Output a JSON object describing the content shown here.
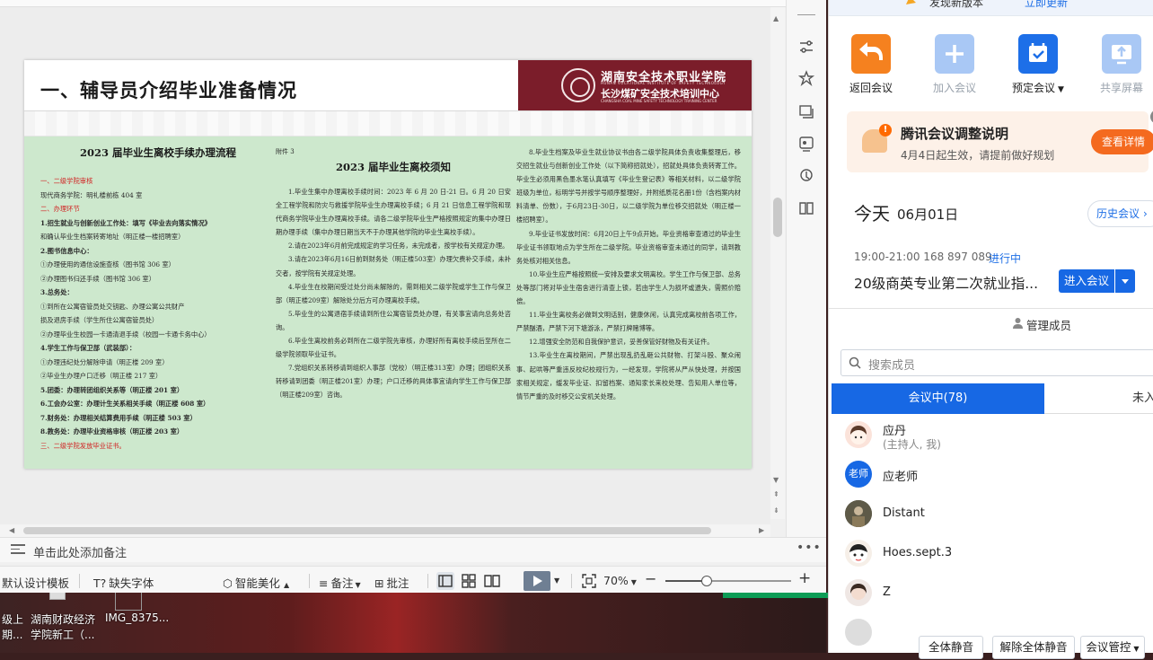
{
  "editor": {
    "notes_placeholder": "单击此处添加备注",
    "statusbar": {
      "template": "默认设计模板",
      "missing_fonts": "缺失字体",
      "smart_beautify": "智能美化",
      "notes": "备注",
      "comment": "批注",
      "zoom": "70%",
      "zoom_level": 0.33
    }
  },
  "slide": {
    "title": "一、辅导员介绍毕业准备情况",
    "logo_line1": "湖南安全技术职业学院",
    "logo_line2": "HUNAN VOCATIONAL INSTITUTE OF SAFETY TECHNOLOGY",
    "logo_line3": "长沙煤矿安全技术培训中心",
    "logo_line4": "CHANGSHA COAL MINE SAFETY TECHNOLOGY TRAINING CENTER",
    "col1": {
      "title": "2023 届毕业生离校手续办理流程",
      "lines": [
        {
          "t": "一、二级学院审核",
          "c": "red"
        },
        {
          "t": "现代商务学院：明礼楼前栋 404 室",
          "c": ""
        },
        {
          "t": "二、办理环节",
          "c": "red"
        },
        {
          "t": "1.招生就业与创新创业工作处：填写《毕业去向落实情况》",
          "c": "b"
        },
        {
          "t": "和确认毕业生档案转寄地址（明正楼一楼招聘室）",
          "c": ""
        },
        {
          "t": "2.图书信息中心：",
          "c": "b"
        },
        {
          "t": "①办理使用的通信设施查核（图书馆 306 室）",
          "c": ""
        },
        {
          "t": "②办理图书归还手续（图书馆 306 室）",
          "c": ""
        },
        {
          "t": "3.总务处：",
          "c": "b"
        },
        {
          "t": "①到所在公寓宿管员处交钥匙、办理公寓公共财产",
          "c": ""
        },
        {
          "t": "损及退房手续（学生所住公寓宿管员处）",
          "c": ""
        },
        {
          "t": "②办理毕业生校园一卡通清退手续（校园一卡通卡务中心）",
          "c": ""
        },
        {
          "t": "4.学生工作与保卫部（武装部）：",
          "c": "b"
        },
        {
          "t": "①办理违纪处分解除申请（明正楼 209 室）",
          "c": ""
        },
        {
          "t": "②毕业生办理户口迁移（明正楼 217 室）",
          "c": ""
        },
        {
          "t": "5.团委：办理转团组织关系等（明正楼 201 室）",
          "c": "b"
        },
        {
          "t": "6.工会办公室：办理计生关系相关手续（明正楼 608 室）",
          "c": "b"
        },
        {
          "t": "7.财务处：办理相关结算费用手续（明正楼 503 室）",
          "c": "b"
        },
        {
          "t": "8.教务处：办理毕业资格审核（明正楼 203 室）",
          "c": "b"
        },
        {
          "t": "三、二级学院发放毕业证书。",
          "c": "red"
        }
      ]
    },
    "col2": {
      "annex": "附件 3",
      "title": "2023 届毕业生离校须知",
      "paras": [
        "1.毕业生集中办理离校手续时间：2023 年 6 月 20 日-21 日。6 月 20 日安全工程学院和防灾与救援学院毕业生办理离校手续；6 月 21 日信息工程学院和现代商务学院毕业生办理离校手续。请各二级学院毕业生严格按照规定的集中办理日期办理手续（集中办理日期当天不于办理其他学院的毕业生离校手续）。",
        "2.请在2023年6月前完成规定的学习任务，未完成者，按学校有关规定办理。",
        "3.请在2023年6月16日前到财务处（明正楼503室）办理欠费补交手续，未补交者，按学院有关规定处理。",
        "4.毕业生在校期间受过处分尚未解除的，需到相关二级学院或学生工作与保卫部（明正楼209室）解除处分后方可办理离校手续。",
        "5.毕业生的公寓退宿手续请到所住公寓宿管员处办理，有关事宜请向总务处咨询。",
        "6.毕业生离校前务必到所在二级学院先审核，办理好所有离校手续后至所在二级学院领取毕业证书。",
        "7.党组织关系转移请到组织人事部（党校）（明正楼313室）办理；团组织关系转移请到团委（明正楼201室）办理；户口迁移的具体事宜请向学生工作与保卫部（明正楼209室）咨询。"
      ]
    },
    "col3": {
      "paras": [
        "8.毕业生档案及毕业生就业协议书由各二级学院具体负责收集整理后，移交招生就业与创新创业工作处（以下简称招就处），招就处具体负责转寄工作。毕业生必须用黑色墨水笔认真填写《毕业生登记表》等相关材料，以二级学院班级为单位，标明学号并按学号顺序整理好，并附纸质花名册1份（含档案内材料清单、份数），于6月23日-30日，以二级学院为单位移交招就处（明正楼一楼招聘室）。",
        "9.毕业证书发放时间：6月20日上午9点开始。毕业资格审查通过的毕业生毕业证书领取地点为学生所在二级学院。毕业资格审查未通过的同学，请到教务处核对相关信息。",
        "10.毕业生应严格按照统一安排及要求文明离校。学生工作与保卫部、总务处等部门将对毕业生宿舍进行清查上锁，若由学生人为损坏或遗失，需照价赔偿。",
        "11.毕业生离校务必做到文明话别，健康休闲，认真完成离校前各项工作，严禁酗酒，严禁下河下塘游泳，严禁打牌赌博等。",
        "12.增强安全防范和自我保护意识，妥善保管好财物及有关证件。",
        "13.毕业生在离校期间，严禁出现乱扔乱砸公共财物、打架斗殴、聚众闹事、起哄等严重违反校纪校规行为，一经发现，学院将从严从快处理，并按国家相关规定，缓发毕业证、扣留档案、通知家长来校处理、告知用人单位等，情节严重的及时移交公安机关处理。"
      ]
    }
  },
  "taskbar": {
    "items": [
      "级上",
      "湖南财政经济",
      "IMG_8375...",
      "期...",
      "学院新工（..."
    ]
  },
  "meeting": {
    "update_banner": {
      "text": "发现新版本",
      "link": "立即更新"
    },
    "actions": [
      {
        "label": "返回会议",
        "icon": "return-icon",
        "color": "#f5811f",
        "disabled": false
      },
      {
        "label": "加入会议",
        "icon": "plus-icon",
        "color": "#a9c8f5",
        "disabled": true
      },
      {
        "label": "预定会议",
        "icon": "calendar-icon",
        "color": "#1d6fe8",
        "disabled": false
      },
      {
        "label": "共享屏幕",
        "icon": "share-screen-icon",
        "color": "#a9c8f5",
        "disabled": true
      }
    ],
    "notice": {
      "title": "腾讯会议调整说明",
      "subtitle": "4月4日起生效，请提前做好规划",
      "button": "查看详情"
    },
    "today_label": "今天",
    "today_date": "06月01日",
    "history_button": "历史会议",
    "meeting_item": {
      "time": "19:00-21:00  168 897 089",
      "status": "进行中",
      "title": "20级商英专业第二次就业指...",
      "enter_button": "进入会议"
    },
    "members": {
      "header": "管理成员",
      "search_placeholder": "搜索成员",
      "tab_in": "会议中(78)",
      "tab_out": "未入会",
      "list": [
        {
          "name": "应丹",
          "sub": "(主持人, 我)",
          "avatar": "cartoon"
        },
        {
          "name": "应老师",
          "sub": "",
          "avatar": "老师"
        },
        {
          "name": "Distant",
          "sub": "",
          "avatar": "photo"
        },
        {
          "name": "Hoes.sept.3",
          "sub": "",
          "avatar": "cartoon2"
        },
        {
          "name": "Z",
          "sub": "",
          "avatar": "girl"
        }
      ],
      "bottom_buttons": [
        "全体静音",
        "解除全体静音",
        "会议管控"
      ]
    }
  },
  "colors": {
    "accent_blue": "#1768e4",
    "slide_green": "#cde8cd",
    "logo_maroon": "#7b1d2a",
    "notice_orange": "#f46a1f"
  }
}
